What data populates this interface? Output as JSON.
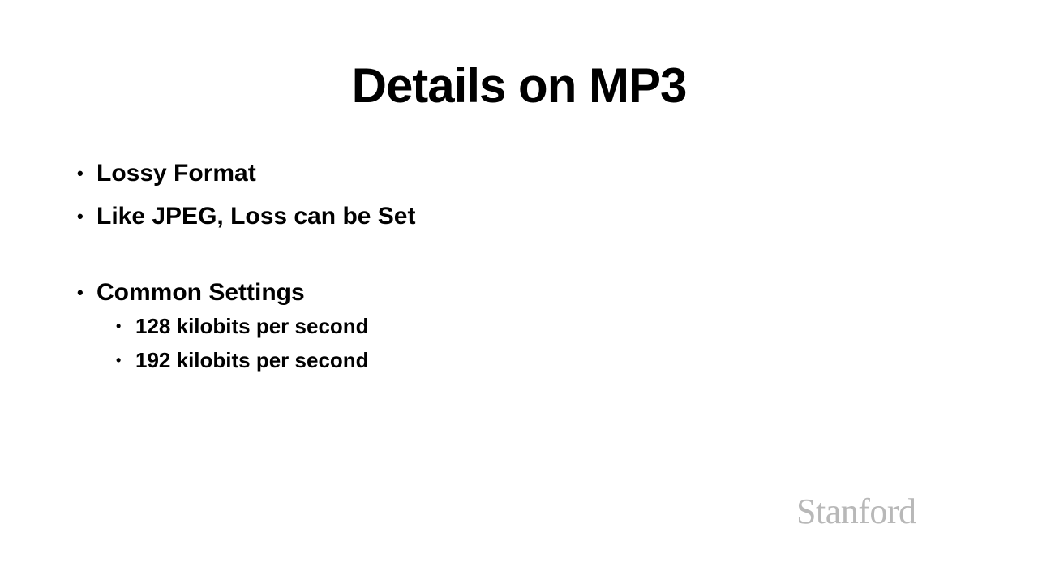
{
  "slide": {
    "title": "Details on MP3",
    "bullets": [
      {
        "text": "Lossy Format"
      },
      {
        "text": "Like JPEG, Loss can be Set"
      },
      {
        "text": "Common Settings",
        "sub_bullets": [
          {
            "text": "128 kilobits per second"
          },
          {
            "text": "192 kilobits per second"
          }
        ]
      }
    ],
    "bullet_glyph": "•",
    "logo_text": "Stanford",
    "colors": {
      "background": "#ffffff",
      "text": "#000000",
      "logo": "#b8b8b8"
    }
  }
}
